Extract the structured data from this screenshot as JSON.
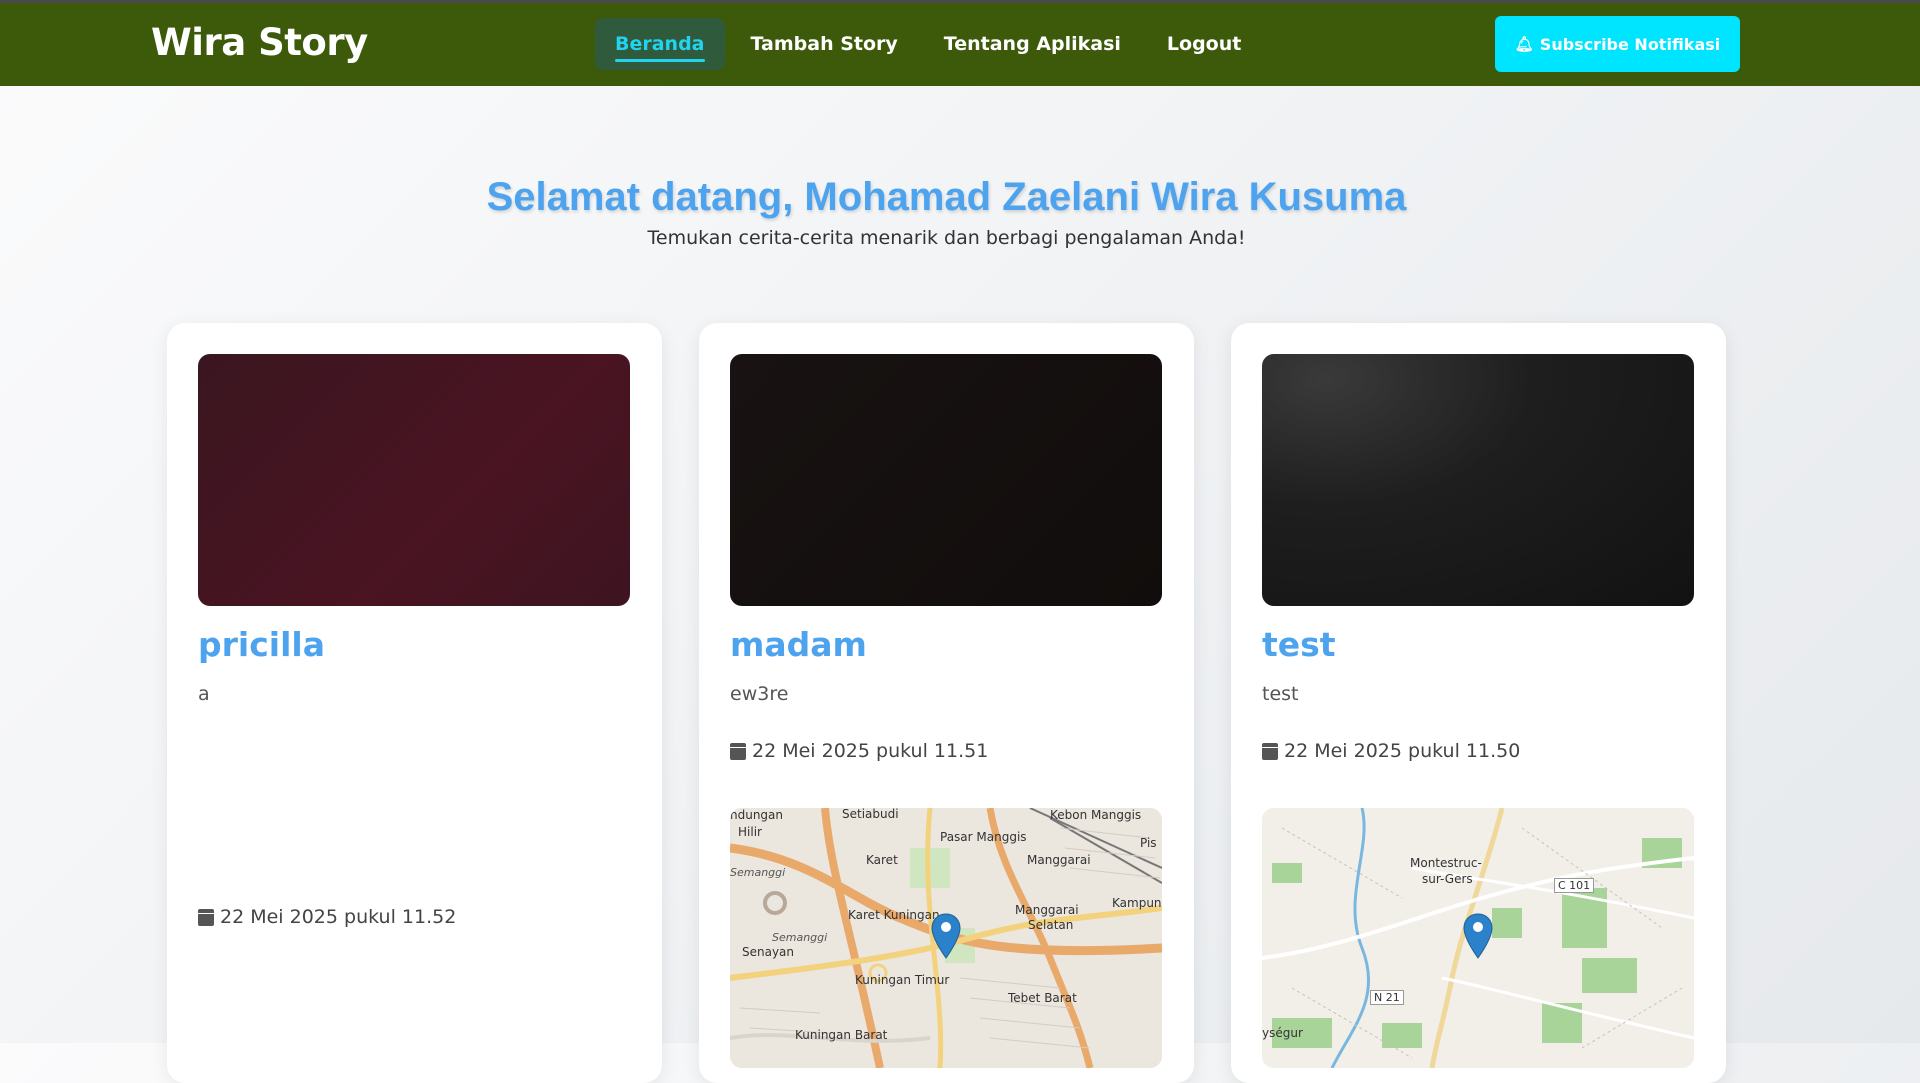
{
  "header": {
    "brand": "Wira Story",
    "nav": [
      {
        "label": "Beranda",
        "active": true
      },
      {
        "label": "Tambah Story",
        "active": false
      },
      {
        "label": "Tentang Aplikasi",
        "active": false
      },
      {
        "label": "Logout",
        "active": false
      }
    ],
    "subscribe_label": "Subscribe Notifikasi",
    "subscribe_icon": "bell-icon"
  },
  "hero": {
    "title": "Selamat datang, Mohamad Zaelani Wira Kusuma",
    "subtitle": "Temukan cerita-cerita menarik dan berbagi pengalaman Anda!"
  },
  "stories": [
    {
      "name": "pricilla",
      "description": "a",
      "date": "22 Mei 2025 pukul 11.52",
      "has_map": false
    },
    {
      "name": "madam",
      "description": "ew3re",
      "date": "22 Mei 2025 pukul 11.51",
      "has_map": true,
      "map_labels": [
        "ndungan",
        "Hilir",
        "Setiabudi",
        "Pasar Manggis",
        "Kebon Manggis",
        "Pis",
        "Semanggi",
        "Karet",
        "Manggarai",
        "Karet Kuningan",
        "Manggarai",
        "Selatan",
        "Kampung",
        "Semanggi",
        "Senayan",
        "Kuningan Timur",
        "Tebet Barat",
        "Kuningan Barat"
      ]
    },
    {
      "name": "test",
      "description": "test",
      "date": "22 Mei 2025 pukul 11.50",
      "has_map": true,
      "map_labels": [
        "Montestruc-",
        "sur-Gers",
        "C 101",
        "N 21",
        "ységur"
      ]
    }
  ],
  "colors": {
    "header_bg": "#3c5a0a",
    "accent": "#4ea3ef",
    "active_nav": "#22d3f0",
    "subscribe_bg": "#00e5ff"
  }
}
